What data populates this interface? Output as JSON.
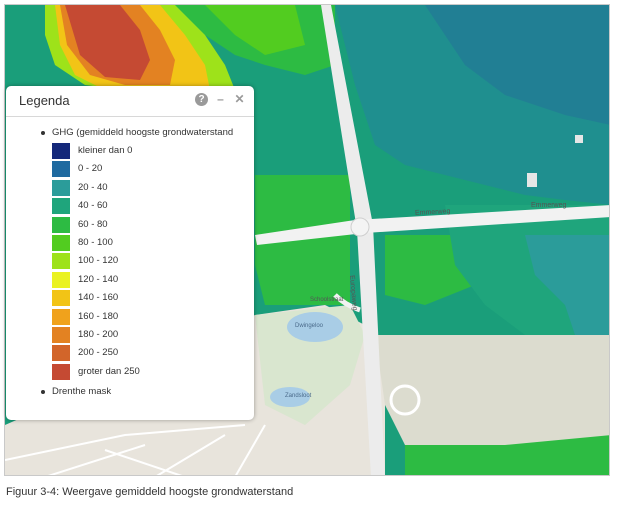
{
  "legend": {
    "title": "Legenda",
    "tools": [
      {
        "icon": "help-icon",
        "glyph": "?"
      },
      {
        "icon": "minimize-icon",
        "glyph": "–"
      },
      {
        "icon": "close-icon",
        "glyph": "✕"
      }
    ],
    "layer_title": "GHG (gemiddeld hoogste grondwaterstand",
    "items": [
      {
        "label": "kleiner dan 0",
        "color": "#14287a"
      },
      {
        "label": "0 - 20",
        "color": "#1f6aa0"
      },
      {
        "label": "20 - 40",
        "color": "#2b9c9a"
      },
      {
        "label": "40 - 60",
        "color": "#1fa57c"
      },
      {
        "label": "60 - 80",
        "color": "#2dbb43"
      },
      {
        "label": "80 - 100",
        "color": "#52cc20"
      },
      {
        "label": "100 - 120",
        "color": "#9ee21a"
      },
      {
        "label": "120 - 140",
        "color": "#eaf222"
      },
      {
        "label": "140 - 160",
        "color": "#f2c416"
      },
      {
        "label": "160 - 180",
        "color": "#f0a21c"
      },
      {
        "label": "180 - 200",
        "color": "#e38222"
      },
      {
        "label": "200 - 250",
        "color": "#d2652a"
      },
      {
        "label": "groter dan 250",
        "color": "#c54a33"
      }
    ],
    "second_layer": "Drenthe mask"
  },
  "map": {
    "street_labels": [
      "Emmerweg",
      "Emmerweg",
      "Europaweg",
      "Schoolstraat"
    ],
    "place_labels": [
      "Dwingeloo",
      "Zandsloot"
    ]
  },
  "caption": "Figuur 3-4: Weergave gemiddeld hoogste grondwaterstand"
}
